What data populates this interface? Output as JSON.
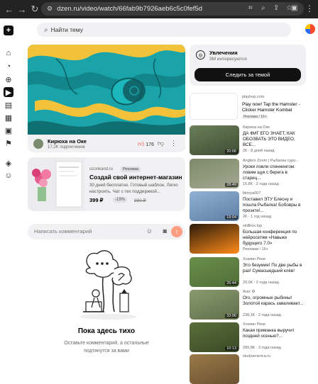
{
  "browser": {
    "url": "dzen.ru/video/watch/66fab9b7926aeb6c5c0fef5d"
  },
  "search": {
    "placeholder": "Найти тему"
  },
  "video": {
    "channel": "Кирюха на Оке",
    "subscribers": "17,2K подписчиков",
    "likes": "176"
  },
  "ad": {
    "source": "ozonkand.ru",
    "badge": "Реклама",
    "title": "Создай свой интернет-магазин бе...",
    "description": "30 дней бесплатно. Готовый шаблон. Легко настроить. Чат с тех поддержкой...",
    "price": "399 ₽",
    "discount": "-19%",
    "old_price": "990 ₽"
  },
  "comments": {
    "placeholder": "Написать комментарий",
    "empty_title": "Пока здесь тихо",
    "empty_sub1": "Оставьте комментарий, а остальные",
    "empty_sub2": "подтянутся за вами"
  },
  "interests": {
    "title": "Увлечения",
    "subtitle": "3М интересуются",
    "button": "Следить за темой"
  },
  "side_ad": {
    "source": "playhop.com",
    "title": "Play now! Tap the Hamster - Clicker Hamster Kombat",
    "badge": "Реклама / 16+"
  },
  "recommendations": [
    {
      "channel": "Кирюха на Оке",
      "title": "ДА ФИГ ЕГО ЗНАЕТ, КАК ОБОЗВАТЬ ЭТО ВИДЕО, ВСЕ...",
      "meta": "2К · 8 дней назад",
      "duration": "20:06",
      "colors": [
        "#6b7f5a",
        "#3e4d33"
      ]
    },
    {
      "channel": "Anglers Zoom | Рыбалка суро...",
      "title": "Уроки ловли спиннингом: ловим щук с берега в стариц...",
      "meta": "15,8К · 2 года назад",
      "duration": "28:49",
      "colors": [
        "#7d8a6a",
        "#a5a890"
      ]
    },
    {
      "channel": "blinrya007",
      "title": "Поставил ЭТУ Блесну и пошла Рыбалка! Бобовры в проэкте!...",
      "meta": "2К · 1 год назад",
      "duration": "19:04",
      "colors": [
        "#8fb1d4",
        "#5c7fa3"
      ]
    },
    {
      "channel": "skillbox.top",
      "title": "Большая конференция по нейросетям «Навыки будущего 7.0»",
      "meta": "Реклама / 16+",
      "duration": "",
      "colors": [
        "#2a1a0a",
        "#ff8c1a"
      ]
    },
    {
      "channel": "Хозяин Реки",
      "title": "Это безумие! По две рыбы в раз! Сумасшедший клёв!",
      "meta": "20,9К · 2 года назад",
      "duration": "25:44",
      "colors": [
        "#6a8f4a",
        "#4f6e39"
      ]
    },
    {
      "channel": "Агат ⚙",
      "title": "Ого, огромные рыбины! Золотой карась заваливает...",
      "meta": "238,1К · 2 года назад",
      "duration": "33:06",
      "colors": [
        "#8a9a70",
        "#5f6e48"
      ]
    },
    {
      "channel": "Хозяин Реки",
      "title": "Какая приманка выручит поздней осенью?...",
      "meta": "280,8К · 3 года назад",
      "duration": "10:13",
      "colors": [
        "#5a6e3a",
        "#3a4a26"
      ]
    },
    {
      "channel": "studyamerica.ru",
      "title": "",
      "meta": "",
      "duration": "",
      "colors": [
        "#9a7a4a",
        "#6a5030"
      ]
    }
  ]
}
